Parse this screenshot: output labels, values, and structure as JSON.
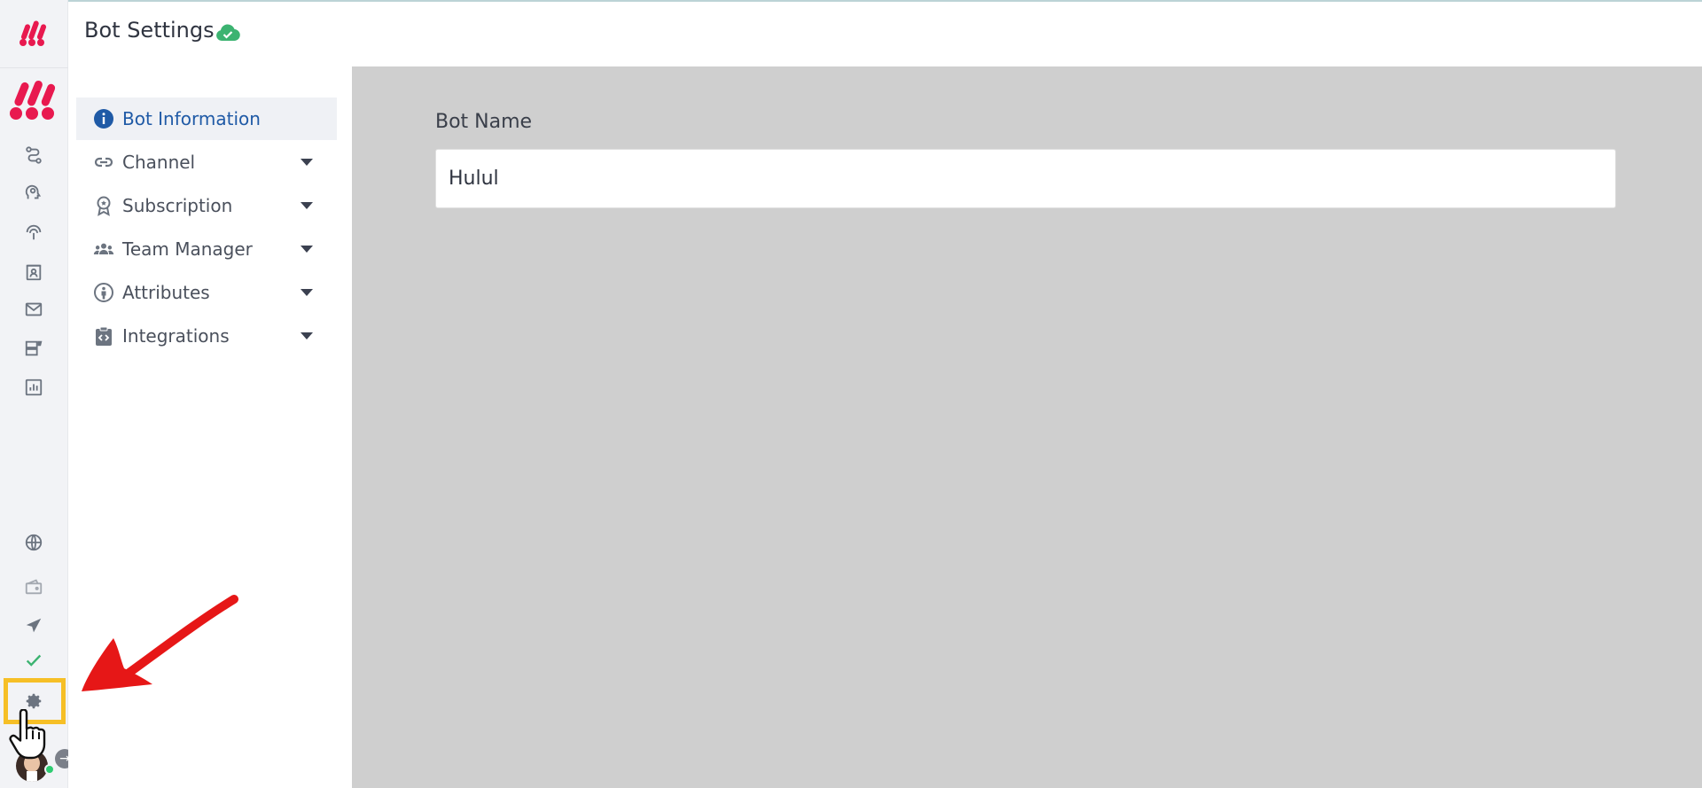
{
  "header": {
    "title": "Bot Settings",
    "status_icon": "cloud-check-icon",
    "status_color": "#3cb371"
  },
  "rail": {
    "top_icons": [
      "flow-icon",
      "brain-gear-icon",
      "broadcast-icon",
      "contacts-icon",
      "mail-icon",
      "templates-icon",
      "analytics-icon"
    ],
    "bottom_icons": [
      "globe-icon",
      "wallet-icon",
      "send-icon",
      "check-icon",
      "gear-icon"
    ],
    "brand_color": "#e8194f",
    "highlight_color": "#f6bf26"
  },
  "settings_nav": {
    "items": [
      {
        "label": "Bot Information",
        "icon": "info-icon",
        "active": true
      },
      {
        "label": "Channel",
        "icon": "link-icon",
        "active": false
      },
      {
        "label": "Subscription",
        "icon": "award-icon",
        "active": false
      },
      {
        "label": "Team Manager",
        "icon": "team-icon",
        "active": false
      },
      {
        "label": "Attributes",
        "icon": "person-icon",
        "active": false
      },
      {
        "label": "Integrations",
        "icon": "code-clipboard-icon",
        "active": false
      }
    ]
  },
  "form": {
    "bot_name_label": "Bot Name",
    "bot_name_value": "Hulul"
  },
  "user": {
    "status": "online",
    "status_color": "#2ecc71"
  }
}
